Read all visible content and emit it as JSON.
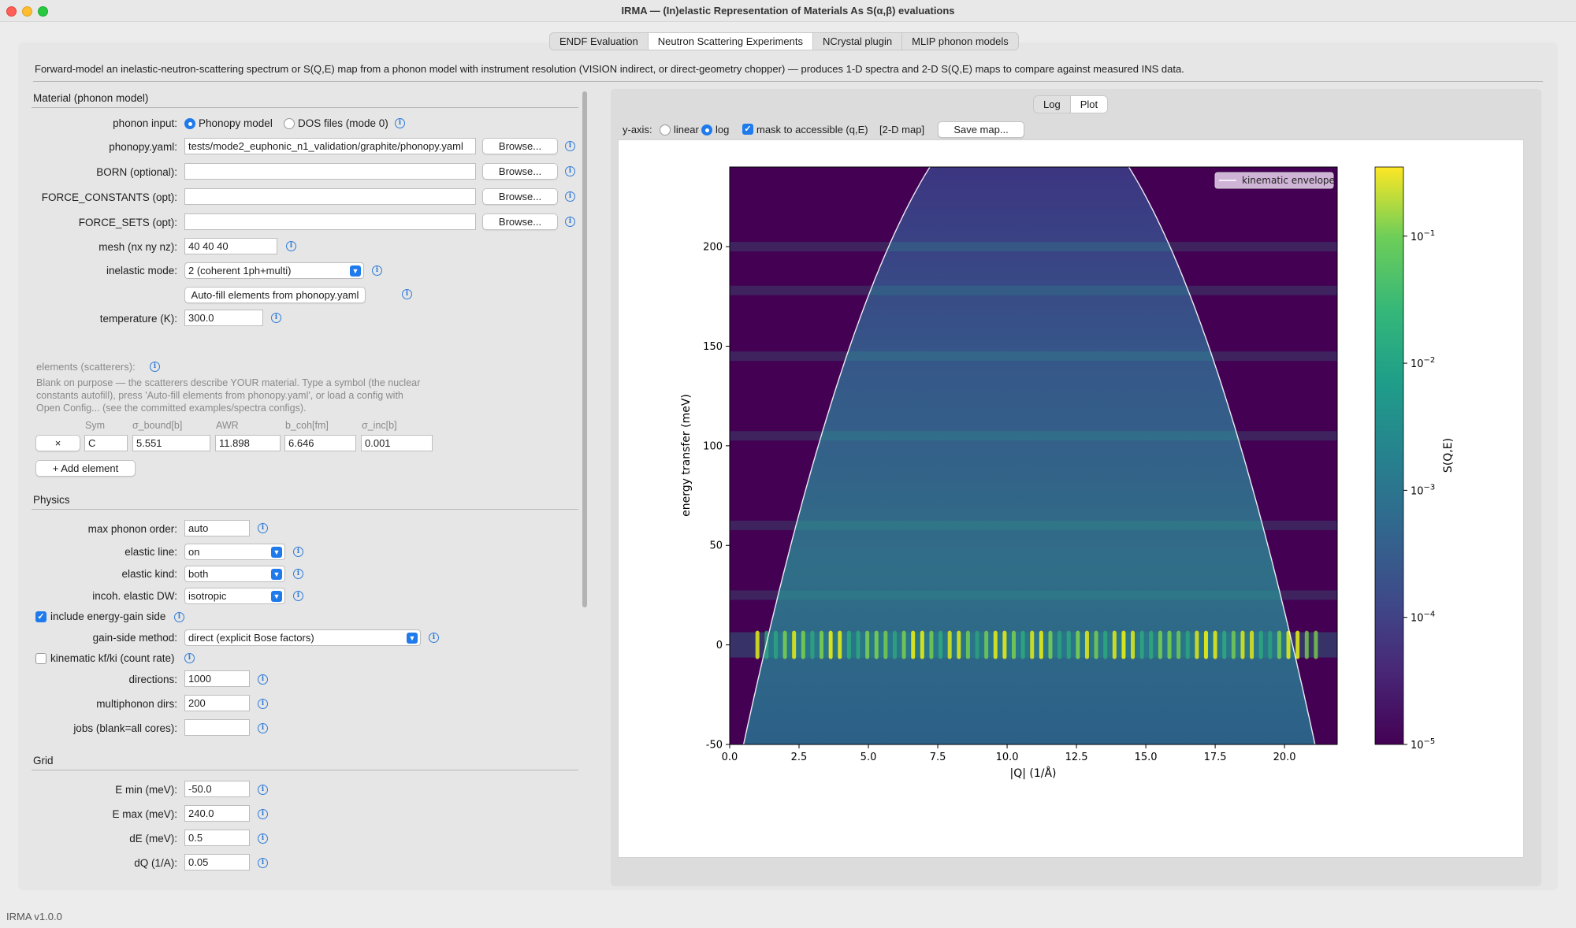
{
  "window": {
    "title": "IRMA — (In)elastic Representation of Materials As S(α,β) evaluations"
  },
  "tabs": [
    "ENDF Evaluation",
    "Neutron Scattering Experiments",
    "NCrystal plugin",
    "MLIP phonon models"
  ],
  "active_tab": "Neutron Scattering Experiments",
  "description": "Forward-model an inelastic-neutron-scattering spectrum or S(Q,E) map from a phonon model with instrument resolution (VISION indirect, or direct-geometry chopper) — produces 1-D spectra and 2-D S(Q,E) maps to compare against measured INS data.",
  "material": {
    "section": "Material (phonon model)",
    "phonon_input_label": "phonon input:",
    "phonon_input_options": [
      "Phonopy model",
      "DOS files (mode 0)"
    ],
    "phonon_input_selected": "Phonopy model",
    "phonopy_label": "phonopy.yaml:",
    "phonopy_value": "tests/mode2_euphonic_n1_validation/graphite/phonopy.yaml",
    "born_label": "BORN (optional):",
    "born_value": "",
    "fc_label": "FORCE_CONSTANTS (opt):",
    "fc_value": "",
    "fs_label": "FORCE_SETS (opt):",
    "fs_value": "",
    "browse": "Browse...",
    "mesh_label": "mesh (nx ny nz):",
    "mesh_value": "40 40 40",
    "mode_label": "inelastic mode:",
    "mode_value": "2 (coherent 1ph+multi)",
    "autofill": "Auto-fill elements from phonopy.yaml",
    "temp_label": "temperature (K):",
    "temp_value": "300.0"
  },
  "elements": {
    "header": "elements (scatterers):",
    "hint1": "Blank on purpose — the scatterers describe YOUR material. Type a symbol (the nuclear",
    "hint2": "constants autofill), press 'Auto-fill elements from phonopy.yaml', or load a config with",
    "hint3": "Open Config... (see the committed examples/spectra configs).",
    "columns": [
      "Sym",
      "σ_bound[b]",
      "AWR",
      "b_coh[fm]",
      "σ_inc[b]"
    ],
    "rows": [
      {
        "remove": "×",
        "sym": "C",
        "sigma_bound": "5.551",
        "awr": "11.898",
        "b_coh": "6.646",
        "sigma_inc": "0.001"
      }
    ],
    "add": "+ Add element"
  },
  "physics": {
    "section": "Physics",
    "max_order_label": "max phonon order:",
    "max_order_value": "auto",
    "elastic_line_label": "elastic line:",
    "elastic_line_value": "on",
    "elastic_kind_label": "elastic kind:",
    "elastic_kind_value": "both",
    "incoh_dw_label": "incoh. elastic DW:",
    "incoh_dw_value": "isotropic",
    "gain_side_label": "include energy-gain side",
    "gain_side_checked": true,
    "gain_method_label": "gain-side method:",
    "gain_method_value": "direct (explicit Bose factors)",
    "kfki_label": "kinematic kf/ki (count rate)",
    "kfki_checked": false,
    "directions_label": "directions:",
    "directions_value": "1000",
    "multiphonon_label": "multiphonon dirs:",
    "multiphonon_value": "200",
    "jobs_label": "jobs (blank=all cores):",
    "jobs_value": ""
  },
  "grid": {
    "section": "Grid",
    "emin_label": "E min (meV):",
    "emin_value": "-50.0",
    "emax_label": "E max (meV):",
    "emax_value": "240.0",
    "de_label": "dE (meV):",
    "de_value": "0.5",
    "dq_label": "dQ (1/A):",
    "dq_value": "0.05"
  },
  "right": {
    "log_tab": "Log",
    "plot_tab": "Plot",
    "active": "Plot",
    "yaxis_label": "y-axis:",
    "linear": "linear",
    "log": "log",
    "yaxis_selected": "log",
    "mask_label": "mask to accessible (q,E)",
    "mask_checked": true,
    "map_tag": "[2-D map]",
    "save": "Save map..."
  },
  "chart_data": {
    "type": "heatmap",
    "xlabel": "|Q| (1/Å)",
    "ylabel": "energy transfer (meV)",
    "colorbar_label": "S(Q,E)",
    "xlim": [
      0,
      21.9
    ],
    "ylim": [
      -50,
      240
    ],
    "xticks": [
      "0.0",
      "2.5",
      "5.0",
      "7.5",
      "10.0",
      "12.5",
      "15.0",
      "17.5",
      "20.0"
    ],
    "yticks": [
      "-50",
      "0",
      "50",
      "100",
      "150",
      "200"
    ],
    "colorbar_scale": "log",
    "colorbar_range": [
      1e-05,
      0.35
    ],
    "colorbar_ticks": [
      "10^-1",
      "10^-2",
      "10^-3",
      "10^-4",
      "10^-5"
    ],
    "legend": "kinematic envelope",
    "legend_position": "top-right",
    "envelope": {
      "q_center": 10.8,
      "half_width_at_E_min": 10.3,
      "E_peak": 280
    },
    "elastic_line_E": 0,
    "phonon_bands_E": [
      25,
      60,
      105,
      145,
      178,
      200
    ]
  },
  "status": "IRMA v1.0.0"
}
